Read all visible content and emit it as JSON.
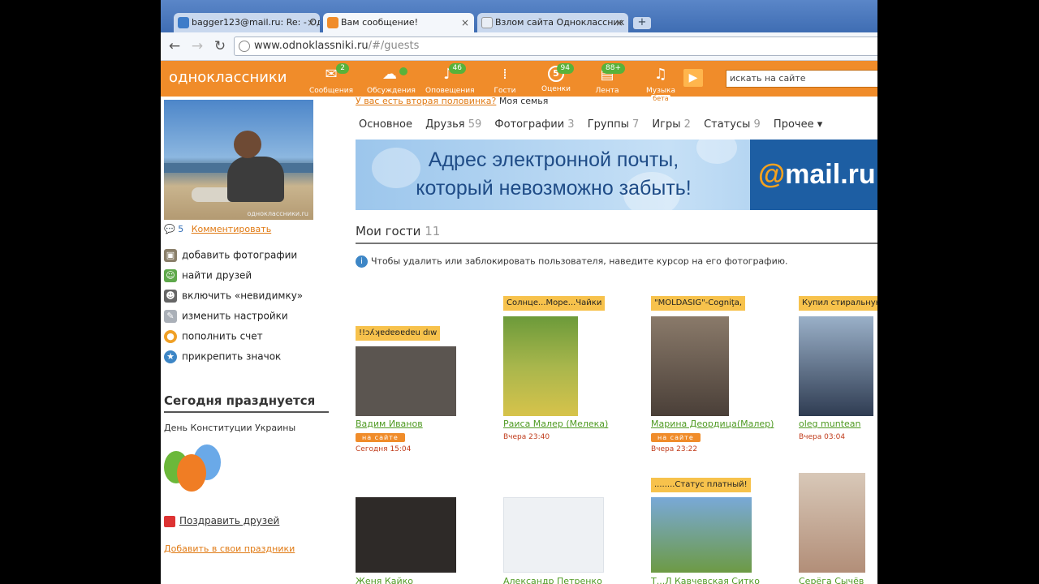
{
  "browser": {
    "tabs": [
      {
        "title": "bagger123@mail.ru: Re: - Од",
        "active": false
      },
      {
        "title": "Вам сообщение!",
        "active": true
      },
      {
        "title": "Взлом сайта Одноклассник",
        "active": false
      }
    ],
    "url_main": "www.odnoklassniki.ru",
    "url_path": "/#/guests"
  },
  "header": {
    "logo": "одноклассники",
    "nav": [
      {
        "label": "Сообщения",
        "badge": "2",
        "icon": "envelope-icon"
      },
      {
        "label": "Обсуждения",
        "badge": "",
        "icon": "chat-icon"
      },
      {
        "label": "Оповещения",
        "badge": "46",
        "icon": "bell-icon"
      },
      {
        "label": "Гости",
        "badge": "",
        "icon": "footprints-icon"
      },
      {
        "label": "Оценки",
        "badge": "94",
        "icon": "rating-icon"
      },
      {
        "label": "Лента",
        "badge": "88+",
        "icon": "feed-icon"
      },
      {
        "label": "Музыка",
        "badge": "",
        "icon": "music-icon"
      }
    ],
    "music_beta": "бета",
    "rating_number": "5",
    "search_placeholder": "искать на сайте"
  },
  "left": {
    "photo_watermark": "одноклассники.ru",
    "comment_count": "5",
    "comment_link": "Комментировать",
    "actions": [
      {
        "label": "добавить фотографии",
        "icon": "camera-icon"
      },
      {
        "label": "найти друзей",
        "icon": "find-friends-icon"
      },
      {
        "label": "включить «невидимку»",
        "icon": "invisible-icon"
      },
      {
        "label": "изменить настройки",
        "icon": "wrench-icon"
      },
      {
        "label": "пополнить счет",
        "icon": "coin-icon"
      },
      {
        "label": "прикрепить значок",
        "icon": "badge-icon"
      }
    ],
    "celebrate_title": "Сегодня празднуется",
    "holiday": "День Конституции Украины",
    "congrats_link": "Поздравить друзей",
    "add_holiday_link": "Добавить в свои праздники"
  },
  "main": {
    "top_cut_link": "У вас есть вторая половинка?",
    "top_cut_text": "Моя семья",
    "tabs": [
      {
        "label": "Основное",
        "count": ""
      },
      {
        "label": "Друзья",
        "count": "59"
      },
      {
        "label": "Фотографии",
        "count": "3"
      },
      {
        "label": "Группы",
        "count": "7"
      },
      {
        "label": "Игры",
        "count": "2"
      },
      {
        "label": "Статусы",
        "count": "9"
      },
      {
        "label": "Прочее ▾",
        "count": ""
      }
    ],
    "banner_line1": "Адрес электронной почты,",
    "banner_line2": "который невозможно забыть!",
    "banner_brand_at": "@",
    "banner_brand": "mail.ru",
    "guests_title": "Мои гости",
    "guests_count": "11",
    "hint": "Чтобы удалить или заблокировать пользователя, наведите курсор на его фотографию.",
    "guests": [
      {
        "status": "!!ɔʎʞɐdɐʚɐdɐu dıw",
        "name": "Вадим Иванов",
        "online": "на сайте",
        "time": "Сегодня 15:04",
        "photo_color": "#5b5550"
      },
      {
        "status": "Солнце...Море...Чайки",
        "name": "Раиса Малер (Мелека)",
        "online": "",
        "time": "Вчера 23:40",
        "photo_color": "#8aa744"
      },
      {
        "status": "\"MOLDASIG\"-Cogniţa,",
        "name": "Марина Деордица(Малер)",
        "online": "на сайте",
        "time": "Вчера 23:22",
        "photo_color": "#5e4b3e"
      },
      {
        "status": "Купил стиральную",
        "name": "oleg muntean",
        "online": "",
        "time": "Вчера 03:04",
        "photo_color": "#7b8fa8"
      },
      {
        "status": "",
        "name": "Женя Кайко",
        "online": "",
        "time": "",
        "photo_color": "#2e2a28"
      },
      {
        "status": "",
        "name": "Александр Петренко",
        "online": "",
        "time": "",
        "photo_color": "#eef1f4"
      },
      {
        "status": "........Статус платный!",
        "name": "Т...Л Кавчевская Ситко",
        "online": "",
        "time": "",
        "photo_color": "#79a9d8"
      },
      {
        "status": "",
        "name": "Серёга Сычёв",
        "online": "",
        "time": "",
        "photo_color": "#b28e78"
      }
    ]
  }
}
